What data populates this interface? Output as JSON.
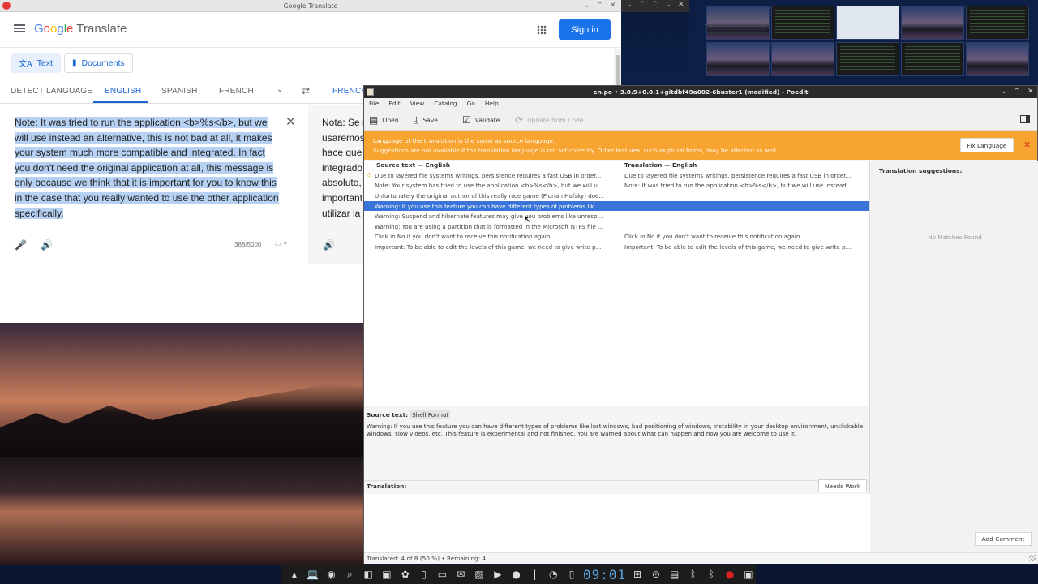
{
  "google_translate": {
    "window_title": "Google Translate",
    "logo_product": "Translate",
    "signin_label": "Sign in",
    "mode_text": "Text",
    "mode_documents": "Documents",
    "lang_detect": "DETECT LANGUAGE",
    "lang_english": "ENGLISH",
    "lang_spanish": "SPANISH",
    "lang_french": "FRENCH",
    "lang_target_french": "FRENCH",
    "source_text": "Note: It was tried to run the application <b>%s</b>, but we will use instead an alternative, this is not bad at all, it makes your system much more compatible and integrated. In fact you don't need the original application at all, this message is only because we think that it is important for you to know this in the case that you really wanted to use the other application specifically.",
    "target_lines": [
      "Nota: Se i",
      "usaremos",
      "hace que",
      "integrado",
      "absoluto,",
      "important",
      "utilizar la"
    ],
    "char_count": "388/5000"
  },
  "poedit": {
    "window_title": "en.po • 3.8.9+0.0.1+gitdbf49a002-6buster1 (modified) - Poedit",
    "menu": [
      "File",
      "Edit",
      "View",
      "Catalog",
      "Go",
      "Help"
    ],
    "toolbar": {
      "open": "Open",
      "save": "Save",
      "validate": "Validate",
      "update": "Update from Code"
    },
    "warning_title": "Language of the translation is the same as source language.",
    "warning_detail": "Suggestions are not available if the translation language is not set correctly. Other features, such as plural forms, may be affected as well.",
    "fix_language": "Fix Language",
    "col_source": "Source text — English",
    "col_translation": "Translation — English",
    "rows": [
      {
        "src": "Due to layered file systems writings, persistence requires a fast USB in order...",
        "tr": "Due to layered file systems writings, persistence requires a fast USB in order..."
      },
      {
        "src": "Note: Your system has tried to use the application <b>%s</b>, but we will u...",
        "tr": "Note: It was tried to run the application <b>%s</b>, but we will use instead ..."
      },
      {
        "src": "Unfortunately the original author of this really nice game (Florian Hufsky) doe...",
        "tr": ""
      },
      {
        "src": "Warning: If you use this feature you can have different types of problems lik...",
        "tr": ""
      },
      {
        "src": "Warning: Suspend and hibernate features may give you problems like unresp...",
        "tr": ""
      },
      {
        "src": "Warning: You are using a partition that is formatted in the Microsoft NTFS file ...",
        "tr": ""
      },
      {
        "src": "Click in No if you don't want to receive this notification again",
        "tr": "Click in No if you don't want to receive this notification again"
      },
      {
        "src": "Important: To be able to edit the levels of this game, we need to give write p...",
        "tr": "Important: To be able to edit the levels of this game, we need to give write p..."
      }
    ],
    "source_label": "Source text:",
    "source_format": "Shell Format",
    "source_full": "Warning: If you use this feature you can have different types of problems like lost windows, bad positioning of windows, instability in your desktop environment, unclickable windows, slow videos, etc. This feature is experimental and not finished. You are warned about what can happen and now you are welcome to use it.",
    "translation_label": "Translation:",
    "needs_work": "Needs Work",
    "suggestions_title": "Translation suggestions:",
    "no_matches": "No Matches Found",
    "add_comment": "Add Comment",
    "status": "Translated: 4 of 8 (50 %)  •  Remaining: 4"
  },
  "taskbar": {
    "clock": "09:01"
  },
  "colors": {
    "google_blue": "#1a73e8",
    "poedit_warning": "#f7a431",
    "poedit_selection": "#3a74d8"
  }
}
